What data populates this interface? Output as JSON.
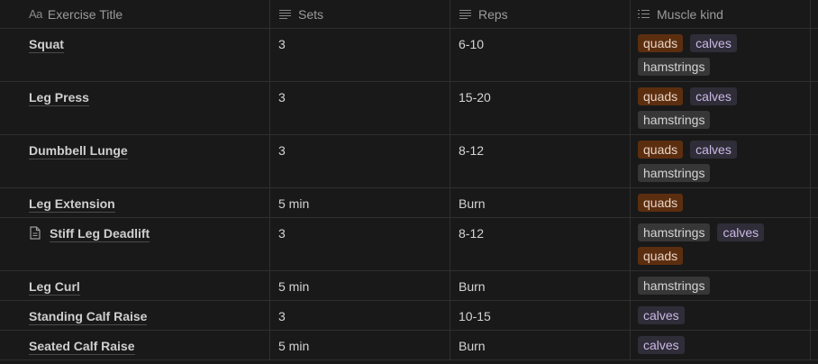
{
  "columns": {
    "title": "Exercise Title",
    "title_icon": "Aa",
    "sets": "Sets",
    "reps": "Reps",
    "muscle": "Muscle kind"
  },
  "rows": [
    {
      "title": "Squat",
      "sets": "3",
      "reps": "6-10",
      "tags": [
        "quads",
        "calves",
        "hamstrings"
      ],
      "doc": false
    },
    {
      "title": "Leg Press",
      "sets": "3",
      "reps": "15-20",
      "tags": [
        "quads",
        "calves",
        "hamstrings"
      ],
      "doc": false
    },
    {
      "title": "Dumbbell Lunge",
      "sets": "3",
      "reps": "8-12",
      "tags": [
        "quads",
        "calves",
        "hamstrings"
      ],
      "doc": false
    },
    {
      "title": "Leg Extension",
      "sets": "5 min",
      "reps": "Burn",
      "tags": [
        "quads"
      ],
      "doc": false
    },
    {
      "title": "Stiff Leg Deadlift",
      "sets": "3",
      "reps": "8-12",
      "tags": [
        "hamstrings",
        "calves",
        "quads"
      ],
      "doc": true
    },
    {
      "title": "Leg Curl",
      "sets": "5 min",
      "reps": "Burn",
      "tags": [
        "hamstrings"
      ],
      "doc": false
    },
    {
      "title": "Standing Calf Raise",
      "sets": "3",
      "reps": "10-15",
      "tags": [
        "calves"
      ],
      "doc": false
    },
    {
      "title": "Seated Calf Raise",
      "sets": "5 min",
      "reps": "Burn",
      "tags": [
        "calves"
      ],
      "doc": false
    }
  ],
  "icons": {
    "title_column": "text-aa-icon",
    "sets_column": "text-lines-icon",
    "reps_column": "text-lines-icon",
    "muscle_column": "multi-select-list-icon",
    "page": "document-icon"
  },
  "colors": {
    "background": "#191919",
    "quads_tag": "#5c2e10",
    "calves_tag": "#2f2d38",
    "hamstrings_tag": "#373737"
  }
}
